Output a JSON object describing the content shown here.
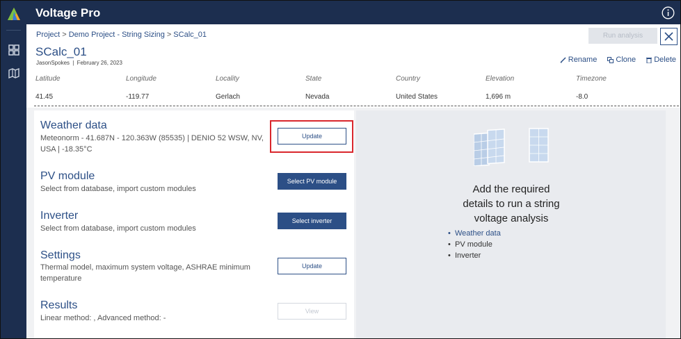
{
  "app": {
    "title": "Voltage Pro"
  },
  "breadcrumb": [
    "Project",
    "Demo Project - String Sizing",
    "SCalc_01"
  ],
  "calc": {
    "name": "SCalc_01",
    "author": "JasonSpokes",
    "date": "February 26, 2023"
  },
  "toolbar": {
    "run_label": "Run analysis",
    "rename_label": "Rename",
    "clone_label": "Clone",
    "delete_label": "Delete"
  },
  "location": {
    "headers": [
      "Latitude",
      "Longitude",
      "Locality",
      "State",
      "Country",
      "Elevation",
      "Timezone"
    ],
    "values": [
      "41.45",
      "-119.77",
      "Gerlach",
      "Nevada",
      "United States",
      "1,696 m",
      "-8.0"
    ]
  },
  "sections": {
    "weather": {
      "title": "Weather data",
      "desc1": "Meteonorm - 41.687N - 120.363W (85535) | DENIO 52 WSW, NV,",
      "desc2": "USA | -18.35°C",
      "button": "Update"
    },
    "pv": {
      "title": "PV module",
      "desc": "Select from database, import custom modules",
      "button": "Select PV module"
    },
    "inverter": {
      "title": "Inverter",
      "desc": "Select from database, import custom modules",
      "button": "Select inverter"
    },
    "settings": {
      "title": "Settings",
      "desc1": "Thermal model, maximum system voltage, ASHRAE minimum",
      "desc2": "temperature",
      "button": "Update"
    },
    "results": {
      "title": "Results",
      "desc": "Linear method: , Advanced method: -",
      "button": "View"
    }
  },
  "right_panel": {
    "message_line1": "Add the required",
    "message_line2": "details to run a string",
    "message_line3": "voltage analysis",
    "checklist": [
      "Weather data",
      "PV module",
      "Inverter"
    ]
  },
  "colors": {
    "navy": "#1c2e4f",
    "accent": "#2c4f86",
    "highlight": "#d9262c"
  }
}
